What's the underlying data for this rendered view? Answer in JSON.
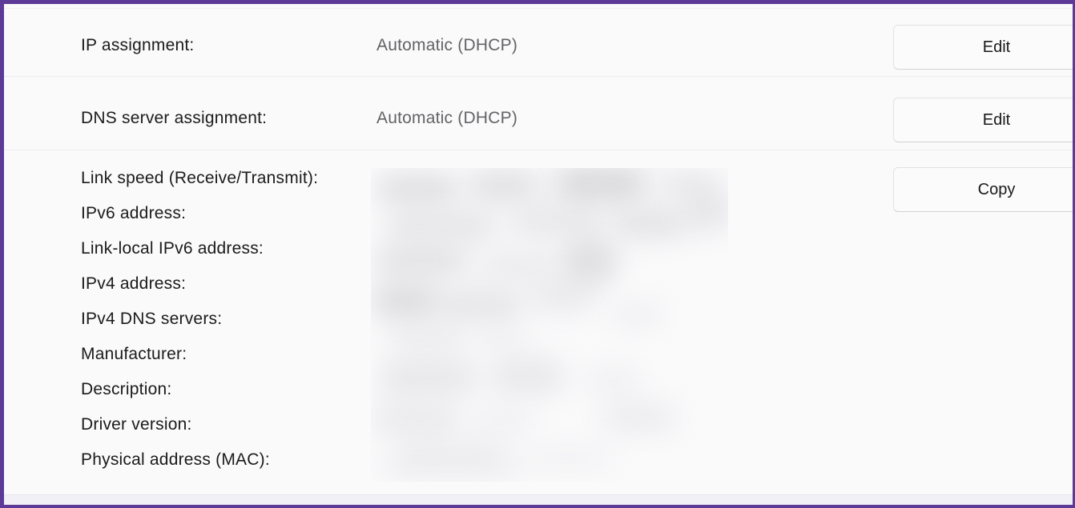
{
  "window": {
    "accent_color": "#5d3a97",
    "surface_color": "#fafafb",
    "divider_color": "#ededf2",
    "label_color": "#1b1b1b",
    "value_color": "#636366"
  },
  "rows": [
    {
      "label": "IP assignment:",
      "value": "Automatic (DHCP)",
      "action": "Edit"
    },
    {
      "label": "DNS server assignment:",
      "value": "Automatic (DHCP)",
      "action": "Edit"
    }
  ],
  "details": {
    "action": "Copy",
    "values_redacted": true,
    "items": [
      {
        "label": "Link speed (Receive/Transmit):",
        "value": ""
      },
      {
        "label": "IPv6 address:",
        "value": ""
      },
      {
        "label": "Link-local IPv6 address:",
        "value": ""
      },
      {
        "label": "IPv4 address:",
        "value": ""
      },
      {
        "label": "IPv4 DNS servers:",
        "value": ""
      },
      {
        "label": "Manufacturer:",
        "value": ""
      },
      {
        "label": "Description:",
        "value": ""
      },
      {
        "label": "Driver version:",
        "value": ""
      },
      {
        "label": "Physical address (MAC):",
        "value": ""
      }
    ]
  }
}
